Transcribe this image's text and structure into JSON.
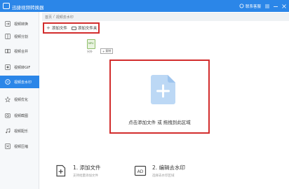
{
  "window": {
    "title": "迅捷视频转换器",
    "contact_label": "联系客服",
    "controls": [
      "minimize",
      "maximize",
      "close"
    ]
  },
  "sidebar": {
    "items": [
      {
        "label": "视频转换",
        "icon": "video-convert-icon",
        "active": false
      },
      {
        "label": "视频分割",
        "icon": "video-split-icon",
        "active": false
      },
      {
        "label": "视频合并",
        "icon": "video-merge-icon",
        "active": false
      },
      {
        "label": "视频转GIF",
        "icon": "gif-icon",
        "active": false
      },
      {
        "label": "视频去水印",
        "icon": "watermark-remove-icon",
        "active": true
      },
      {
        "label": "视频优化",
        "icon": "optimize-icon",
        "active": false
      },
      {
        "label": "视频截图",
        "icon": "screenshot-icon",
        "active": false
      },
      {
        "label": "视频配乐",
        "icon": "music-icon",
        "active": false
      },
      {
        "label": "视频压缩",
        "icon": "compress-icon",
        "active": false
      }
    ]
  },
  "breadcrumb": {
    "home": "首页",
    "separator": "/",
    "current": "视频去水印"
  },
  "toolbar": {
    "add_file": "添加文件",
    "add_folder": "添加文件夹"
  },
  "file": {
    "ext": "MP4",
    "name": "另外"
  },
  "copy_badge": "复制",
  "dropzone": {
    "text": "点击添加文件 或 拖拽到此区域"
  },
  "steps": [
    {
      "title": "1. 添加文件",
      "subtitle": "支持批量添加文件",
      "icon": "add-file-icon"
    },
    {
      "title": "2. 编辑去水印",
      "subtitle": "选择去水印区域",
      "icon": "edit-watermark-icon"
    }
  ],
  "colors": {
    "brand": "#2b86e8",
    "highlight": "#d22d2d",
    "dropzone_icon": "#bcd8f5"
  }
}
